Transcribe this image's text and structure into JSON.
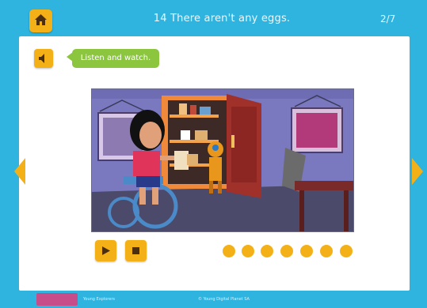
{
  "header": {
    "title": "14 There aren't any eggs.",
    "page_counter": "2/7"
  },
  "instruction": {
    "text": "Listen and watch."
  },
  "footer": {
    "left_text": "Young Explorers",
    "center_text": "© Young Digital Planet SA"
  },
  "media": {
    "progress_dots": 7
  },
  "colors": {
    "header_bg": "#2fb4e0",
    "button_bg": "#f4b117",
    "instruction_bg": "#8cc63f",
    "panel_bg": "#ffffff"
  },
  "icons": {
    "home": "home-icon",
    "audio": "speaker-icon",
    "play": "play-icon",
    "stop": "stop-icon",
    "prev": "arrow-left-icon",
    "next": "arrow-right-icon"
  }
}
